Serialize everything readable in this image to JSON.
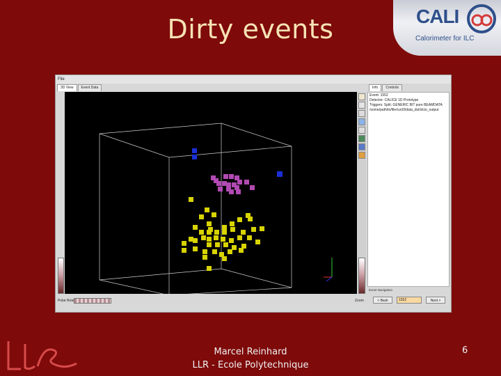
{
  "slide": {
    "title": "Dirty events",
    "author": "Marcel Reinhard",
    "affiliation": "LLR - Ecole Polytechnique",
    "page_number": "6",
    "bg_color": "#7e0a0a",
    "title_color": "#f6e2b4"
  },
  "logo": {
    "text": "CALI",
    "subtitle": "Calorimeter for ILC",
    "llr_mark": "LLR"
  },
  "app": {
    "menu": [
      "File"
    ],
    "left_tabs": [
      "3D View",
      "Event Data"
    ],
    "right_tabs": [
      "Info",
      "Controls"
    ],
    "info_lines": [
      "Event: 1552",
      "Detector: CALICE 1D Prototype",
      "Triggers: Split: GENERIC BIT pure BEAMDATA",
      "/some/path/to/file/run/0/data_dst/slcio_output"
    ],
    "event_navigation_label": "Event Navigation",
    "polar_label": "Polar Rotation",
    "zoom_label": "Zoom",
    "back_button": "< Back",
    "event_number": "1552",
    "next_button": "Next >",
    "toolbar_icons": [
      "pointer-icon",
      "rotate-icon",
      "camera-icon",
      "view-icon",
      "save-icon",
      "eye-icon",
      "pick-icon",
      "palette-icon"
    ],
    "hit_colors": {
      "yellow": "#d8d400",
      "magenta": "#b24ab4",
      "blue": "#1a2fd6"
    },
    "axes_colors": {
      "x": "#e33",
      "y": "#3c3",
      "z": "#33e"
    }
  }
}
